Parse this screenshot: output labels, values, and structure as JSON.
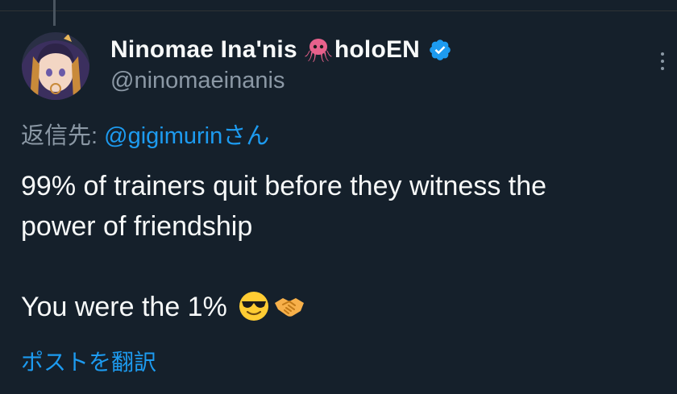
{
  "tweet": {
    "author": {
      "name_part1": "Ninomae Ina'nis",
      "name_emoji": "octopus-icon",
      "name_part2": "holoEN",
      "handle": "@ninomaeinanis",
      "verified": true,
      "verified_color": "#1d9bf0"
    },
    "reply_to": {
      "prefix": "返信先: ",
      "mention": "@gigimurin",
      "suffix": "さん"
    },
    "text_lines": [
      "99% of trainers quit before they witness the",
      "power of friendship",
      "",
      "You were the 1%"
    ],
    "trailing_emojis": [
      "sunglasses-face-icon",
      "handshake-icon"
    ],
    "translate_label": "ポストを翻訳"
  },
  "theme": {
    "background": "#15202b",
    "text_primary": "#f7f9f9",
    "text_secondary": "#8b98a5",
    "accent": "#1d9bf0"
  }
}
